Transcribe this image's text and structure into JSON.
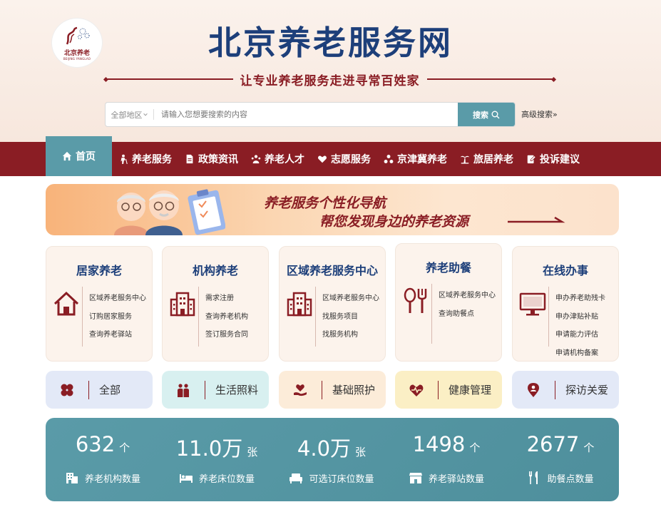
{
  "header": {
    "logo_text": "北京养老",
    "logo_sub": "BEIJING YANGLAO",
    "title": "北京养老服务网",
    "slogan": "让专业养老服务走进寻常百姓家"
  },
  "search": {
    "region": "全部地区",
    "placeholder": "请输入您想要搜索的内容",
    "button": "搜索",
    "advanced": "高级搜索»"
  },
  "nav": {
    "items": [
      {
        "label": "首页",
        "icon": "home-icon",
        "active": true
      },
      {
        "label": "养老服务",
        "icon": "elder-icon"
      },
      {
        "label": "政策资讯",
        "icon": "document-icon"
      },
      {
        "label": "养老人才",
        "icon": "people-icon"
      },
      {
        "label": "志愿服务",
        "icon": "heart-hand-icon"
      },
      {
        "label": "京津冀养老",
        "icon": "network-icon"
      },
      {
        "label": "旅居养老",
        "icon": "palm-tree-icon"
      },
      {
        "label": "投诉建议",
        "icon": "edit-icon"
      }
    ]
  },
  "banner": {
    "line1": "养老服务个性化导航",
    "line2": "帮您发现身边的养老资源"
  },
  "cards": [
    {
      "title": "居家养老",
      "icon": "house-icon",
      "links": [
        "区域养老服务中心",
        "订购居家服务",
        "查询养老驿站"
      ]
    },
    {
      "title": "机构养老",
      "icon": "building-icon",
      "links": [
        "需求注册",
        "查询养老机构",
        "签订服务合同"
      ]
    },
    {
      "title": "区域养老服务中心",
      "icon": "building-icon",
      "links": [
        "区域养老服务中心",
        "找服务项目",
        "找服务机构"
      ]
    },
    {
      "title": "养老助餐",
      "icon": "dining-icon",
      "links": [
        "区域养老服务中心",
        "查询助餐点"
      ]
    },
    {
      "title": "在线办事",
      "icon": "monitor-icon",
      "links": [
        "申办养老助残卡",
        "申办津贴补贴",
        "申请能力评估",
        "申请机构备案"
      ]
    }
  ],
  "categories": [
    {
      "label": "全部",
      "icon": "clover-icon",
      "bg": "#e3e9f7"
    },
    {
      "label": "生活照料",
      "icon": "couple-icon",
      "bg": "#d8f0f0"
    },
    {
      "label": "基础照护",
      "icon": "care-hand-icon",
      "bg": "#fcecd9"
    },
    {
      "label": "健康管理",
      "icon": "heartbeat-icon",
      "bg": "#fbefc5"
    },
    {
      "label": "探访关爱",
      "icon": "location-person-icon",
      "bg": "#e3e9f7"
    }
  ],
  "stats": [
    {
      "value": "632",
      "unit": "个",
      "label": "养老机构数量",
      "icon": "institution-icon"
    },
    {
      "value": "11.0万",
      "unit": "张",
      "label": "养老床位数量",
      "icon": "bed-icon"
    },
    {
      "value": "4.0万",
      "unit": "张",
      "label": "可选订床位数量",
      "icon": "sofa-icon"
    },
    {
      "value": "1498",
      "unit": "个",
      "label": "养老驿站数量",
      "icon": "station-icon"
    },
    {
      "value": "2677",
      "unit": "个",
      "label": "助餐点数量",
      "icon": "utensils-icon"
    }
  ],
  "colors": {
    "primary_red": "#8a1d24",
    "navy": "#1d3f7a",
    "teal": "#5a9ba8"
  }
}
